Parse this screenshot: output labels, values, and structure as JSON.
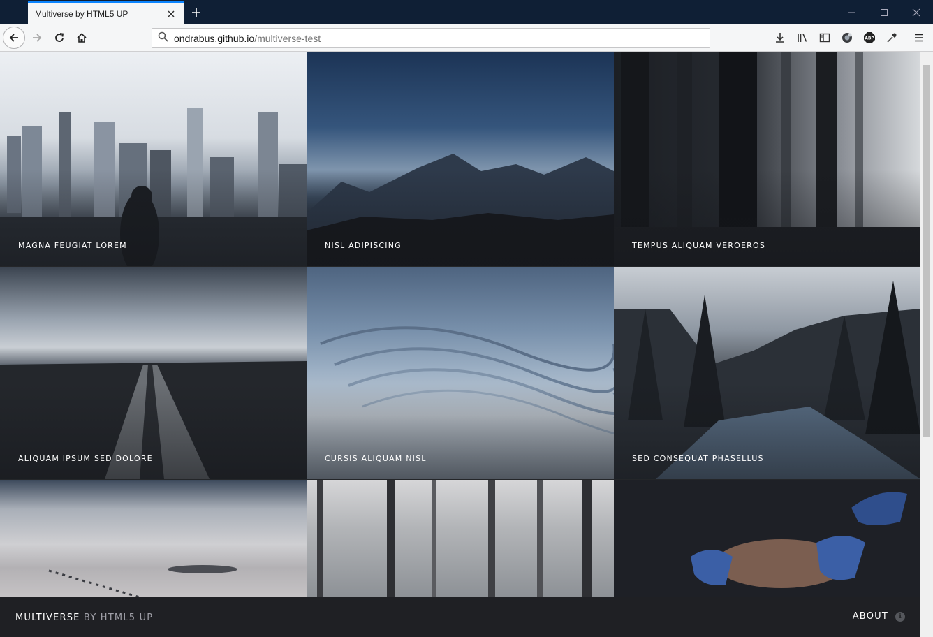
{
  "browser": {
    "tab_title": "Multiverse by HTML5 UP",
    "url_host": "ondrabus.github.io",
    "url_path": "/multiverse-test",
    "icons": [
      "close-icon",
      "plus-icon",
      "minimize-icon",
      "maximize-icon",
      "window-close-icon",
      "back-arrow-icon",
      "forward-arrow-icon",
      "reload-icon",
      "home-icon",
      "search-icon",
      "download-icon",
      "library-icon",
      "sidebar-icon",
      "extension-icon",
      "adblock-icon",
      "eyedropper-icon",
      "menu-icon"
    ],
    "adblock_label": "ABP"
  },
  "gallery": {
    "items": [
      {
        "title": "MAGNA FEUGIAT LOREM"
      },
      {
        "title": "NISL ADIPISCING"
      },
      {
        "title": "TEMPUS ALIQUAM VEROEROS"
      },
      {
        "title": "ALIQUAM IPSUM SED DOLORE"
      },
      {
        "title": "CURSIS ALIQUAM NISL"
      },
      {
        "title": "SED CONSEQUAT PHASELLUS"
      },
      {
        "title": ""
      },
      {
        "title": ""
      },
      {
        "title": ""
      }
    ]
  },
  "footer": {
    "brand_strong": "MULTIVERSE",
    "brand_light": " BY HTML5 UP",
    "about_label": "ABOUT",
    "about_icon_glyph": "i"
  }
}
